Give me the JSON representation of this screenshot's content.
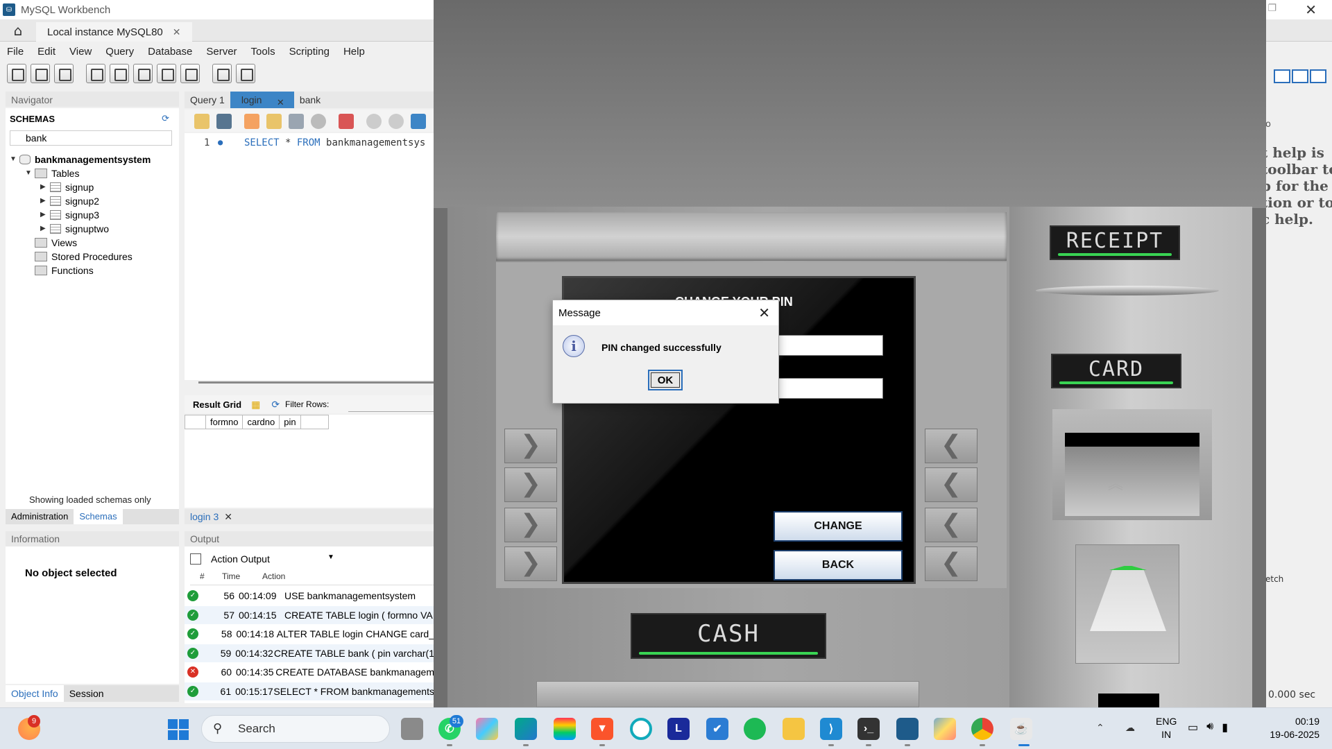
{
  "window": {
    "title": "MySQL Workbench",
    "instance_tab": "Local instance MySQL80",
    "close_glyph": "✕",
    "max_glyph": "❐"
  },
  "menu": [
    "File",
    "Edit",
    "View",
    "Query",
    "Database",
    "Server",
    "Tools",
    "Scripting",
    "Help"
  ],
  "navigator": {
    "header": "Navigator",
    "schemas_label": "SCHEMAS",
    "search_value": "bank",
    "tree": {
      "db": "bankmanagementsystem",
      "tables_label": "Tables",
      "tables": [
        "signup",
        "signup2",
        "signup3",
        "signuptwo"
      ],
      "views": "Views",
      "procs": "Stored Procedures",
      "funcs": "Functions"
    },
    "loaded_note": "Showing loaded schemas only",
    "tabs": [
      "Administration",
      "Schemas"
    ]
  },
  "information": {
    "header": "Information",
    "no_object": "No object selected",
    "tabs": [
      "Object Info",
      "Session"
    ]
  },
  "query": {
    "tabs": [
      "Query 1",
      "login",
      "bank"
    ],
    "line_no": "1",
    "sql_kw1": "SELECT",
    "sql_star": " * ",
    "sql_kw2": "FROM",
    "sql_rest": " bankmanagementsys",
    "result_grid_label": "Result Grid",
    "filter_label": "Filter Rows:",
    "result_columns": [
      "formno",
      "cardno",
      "pin"
    ],
    "bottom_tab": "login 3"
  },
  "output": {
    "header": "Output",
    "selector": "Action Output",
    "columns": [
      "#",
      "Time",
      "Action"
    ],
    "rows": [
      {
        "num": "56",
        "time": "00:14:09",
        "action": "USE bankmanagementsystem",
        "status": "ok"
      },
      {
        "num": "57",
        "time": "00:14:15",
        "action": "CREATE TABLE login (    formno VA",
        "status": "ok"
      },
      {
        "num": "58",
        "time": "00:14:18",
        "action": "ALTER TABLE login CHANGE card_",
        "status": "ok"
      },
      {
        "num": "59",
        "time": "00:14:32",
        "action": "CREATE TABLE bank ( pin varchar(1",
        "status": "ok"
      },
      {
        "num": "60",
        "time": "00:14:35",
        "action": "CREATE DATABASE bankmanagem",
        "status": "err"
      },
      {
        "num": "61",
        "time": "00:15:17",
        "action": "SELECT * FROM bankmanagements",
        "status": "ok"
      }
    ]
  },
  "right_panel": {
    "help_lines": [
      "t help is",
      "toolbar to",
      "p for the",
      "tion or to",
      "c help."
    ],
    "col_fetch": "etch",
    "duration": "0.000 sec",
    "top_letter": "o"
  },
  "atm": {
    "screen_title": "CHANGE YOUR PIN",
    "change_button": "CHANGE",
    "back_button": "BACK",
    "receipt_label": "RECEIPT",
    "card_label": "CARD",
    "cash_label": "CASH",
    "left_key": "❯",
    "right_key": "❮"
  },
  "dialog": {
    "title": "Message",
    "message": "PIN changed successfully",
    "ok": "OK",
    "info_glyph": "i",
    "close_glyph": "✕"
  },
  "taskbar": {
    "weather_badge": "9",
    "search_label": "Search",
    "whatsapp_badge": "51",
    "lang_top": "ENG",
    "lang_bottom": "IN",
    "time": "00:19",
    "date": "19-06-2025"
  }
}
